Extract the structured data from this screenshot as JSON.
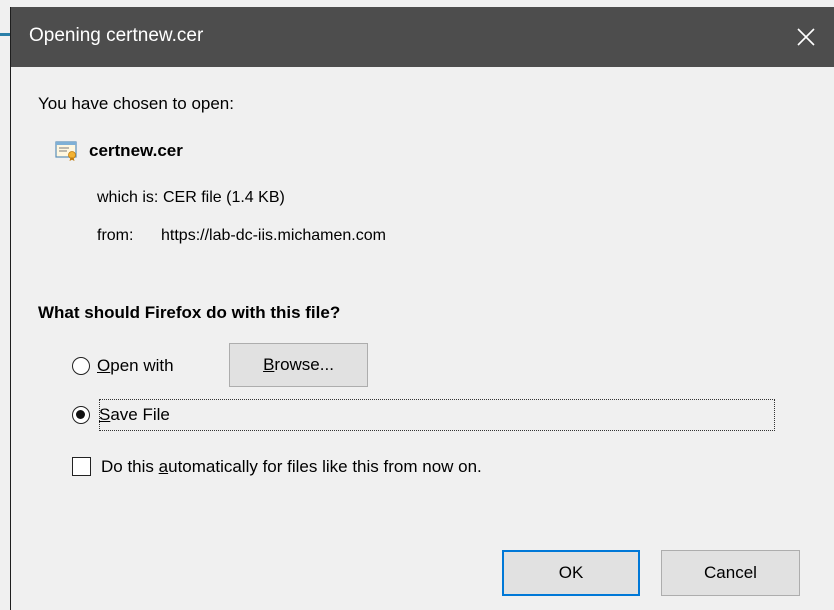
{
  "dialog": {
    "title": "Opening certnew.cer",
    "close_icon": "close-icon"
  },
  "intro_text": "You have chosen to open:",
  "file": {
    "icon": "certificate-file-icon",
    "name": "certnew.cer",
    "which_is_label": "which is:",
    "which_is_value": "CER file (1.4 KB)",
    "from_label": "from:",
    "from_value": "https://lab-dc-iis.michamen.com"
  },
  "question": "What should Firefox do with this file?",
  "options": {
    "open_with": {
      "label_access_key": "O",
      "label_rest": "pen with",
      "selected": false
    },
    "browse_button": {
      "label_access_key": "B",
      "label_rest": "rowse..."
    },
    "save_file": {
      "label_access_key": "S",
      "label_rest": "ave File",
      "selected": true
    },
    "auto_checkbox": {
      "label_before": "Do this ",
      "label_access_key": "a",
      "label_after": "utomatically for files like this from now on.",
      "checked": false
    }
  },
  "buttons": {
    "ok": "OK",
    "cancel": "Cancel"
  },
  "colors": {
    "titlebar": "#4d4d4d",
    "dialog_bg": "#f0f0f0",
    "default_button_border": "#0078d7"
  }
}
